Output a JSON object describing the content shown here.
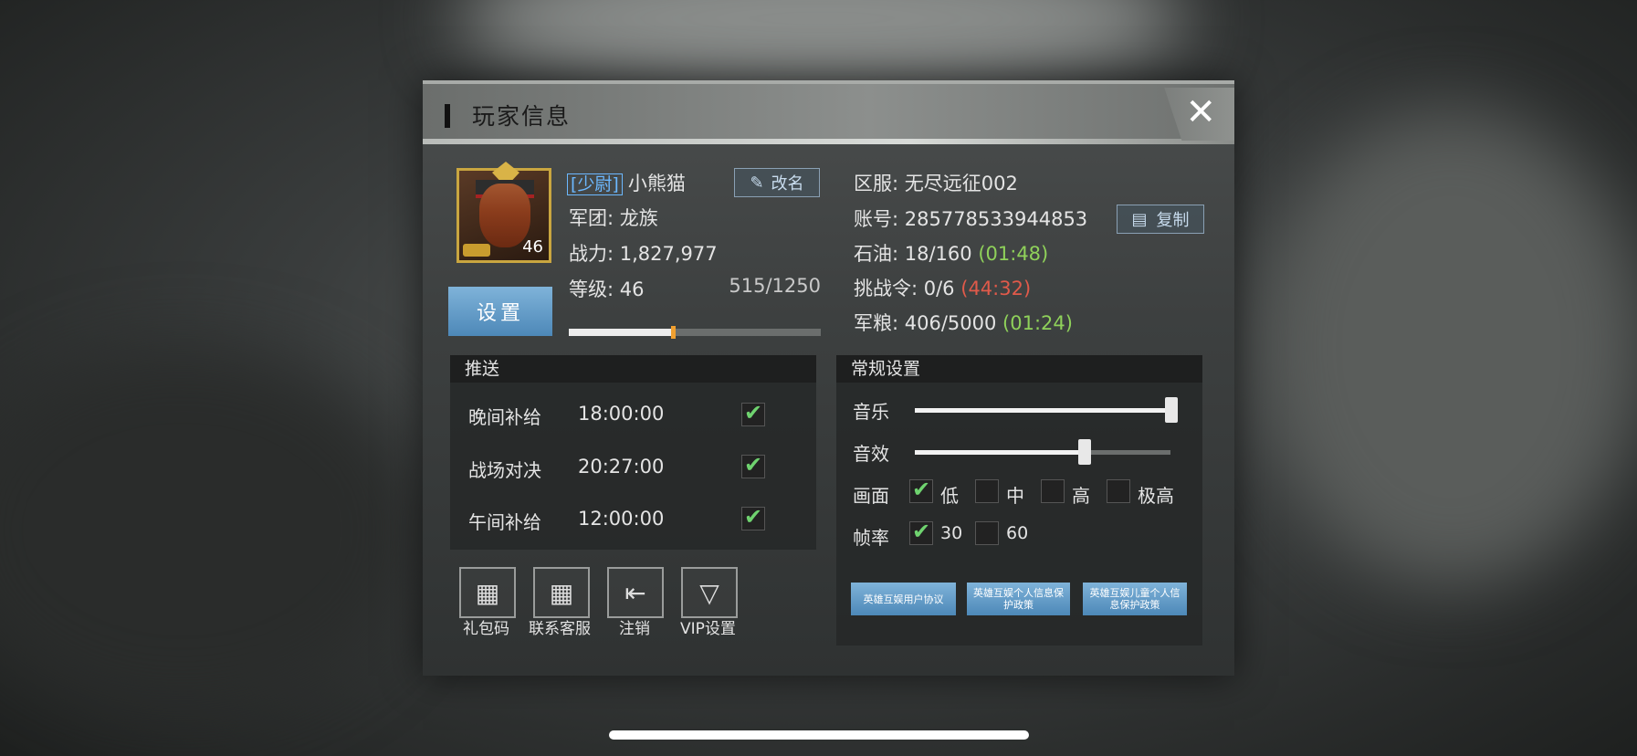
{
  "window": {
    "title": "玩家信息",
    "close_label": "✕"
  },
  "profile": {
    "rank": "[少尉]",
    "name": "小熊猫",
    "rename_label": "改名",
    "avatar_level": "46",
    "legion_label": "军团: 龙族",
    "power_label": "战力: 1,827,977",
    "level_label": "等级: 46",
    "exp_text": "515/1250",
    "exp_fraction": 0.412,
    "settings_label": "设置"
  },
  "server": {
    "server_label": "区服: 无尽远征002",
    "account_label": "账号: 285778533944853",
    "copy_label": "复制",
    "oil_label": "石油: 18/160",
    "oil_timer": "(01:48)",
    "challenge_label": "挑战令: 0/6",
    "challenge_timer": "(44:32)",
    "food_label": "军粮: 406/5000",
    "food_timer": "(01:24)"
  },
  "push": {
    "header": "推送",
    "items": [
      {
        "label": "晚间补给",
        "time": "18:00:00",
        "checked": true
      },
      {
        "label": "战场对决",
        "time": "20:27:00",
        "checked": true
      },
      {
        "label": "午间补给",
        "time": "12:00:00",
        "checked": true
      }
    ]
  },
  "general": {
    "header": "常规设置",
    "music_label": "音乐",
    "music_level": 1.0,
    "sfx_label": "音效",
    "sfx_level": 0.66,
    "quality_label": "画面",
    "quality_options": [
      "低",
      "中",
      "高",
      "极高"
    ],
    "quality_selected": "低",
    "fps_label": "帧率",
    "fps_options": [
      "30",
      "60"
    ],
    "fps_selected": "30",
    "agreement_user": "英雄互娱用户协议",
    "agreement_privacy": "英雄互娱个人信息保护政策",
    "agreement_child": "英雄互娱儿童个人信息保护政策"
  },
  "bottom_buttons": {
    "gift_code": "礼包码",
    "support": "联系客服",
    "logout": "注销",
    "vip": "VIP设置"
  }
}
